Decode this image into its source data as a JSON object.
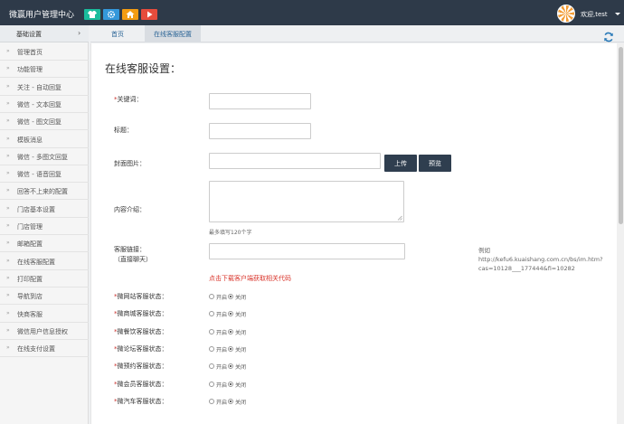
{
  "topbar": {
    "title": "微赢用户管理中心",
    "buttons": [
      {
        "name": "shirt",
        "color": "#1abc9c"
      },
      {
        "name": "gear",
        "color": "#3498db"
      },
      {
        "name": "home",
        "color": "#f39c12"
      },
      {
        "name": "play",
        "color": "#e74c3c"
      }
    ],
    "welcome": "欢迎,test"
  },
  "sidebar": {
    "header": "基础设置",
    "items": [
      "管理首页",
      "功能管理",
      "关注 - 自动回复",
      "微信 - 文本回复",
      "微信 - 图文回复",
      "模板消息",
      "微信 - 多图文回复",
      "微信 - 语音回复",
      "回答不上来的配置",
      "门店基本设置",
      "门店管理",
      "邮箱配置",
      "在线客服配置",
      "打印配置",
      "导航到店",
      "快商客服",
      "微信用户信息授权",
      "在线支付设置"
    ]
  },
  "tabs": [
    {
      "label": "首页",
      "active": false
    },
    {
      "label": "在线客服配置",
      "active": true
    }
  ],
  "form": {
    "title": "在线客服设置：",
    "keyword_label": "关键词：",
    "title_label": "标题：",
    "cover_label": "封面图片：",
    "upload_button": "上传",
    "preview_button": "预览",
    "intro_label": "内容介绍：",
    "intro_hint": "最多填写120个字",
    "link_label_line1": "客服链接：",
    "link_label_line2": "（直接聊天）",
    "link_example": "例如 http://kefu6.kuaishang.com.cn/bs/im.htm?cas=10128___177444&fi=10282",
    "get_code_tip": "点击下载客户端获取相关代码",
    "status_rows": [
      {
        "label": "微网站客服状态：",
        "on": "开启",
        "off": "关闭",
        "selected": "off"
      },
      {
        "label": "微商城客服状态：",
        "on": "开启",
        "off": "关闭",
        "selected": "off"
      },
      {
        "label": "微餐饮客服状态：",
        "on": "开启",
        "off": "关闭",
        "selected": "off"
      },
      {
        "label": "微论坛客服状态：",
        "on": "开启",
        "off": "关闭",
        "selected": "off"
      },
      {
        "label": "微预约客服状态：",
        "on": "开启",
        "off": "关闭",
        "selected": "off"
      },
      {
        "label": "微会员客服状态：",
        "on": "开启",
        "off": "关闭",
        "selected": "off"
      },
      {
        "label": "微汽车客服状态：",
        "on": "开启",
        "off": "关闭",
        "selected": "off"
      }
    ]
  }
}
